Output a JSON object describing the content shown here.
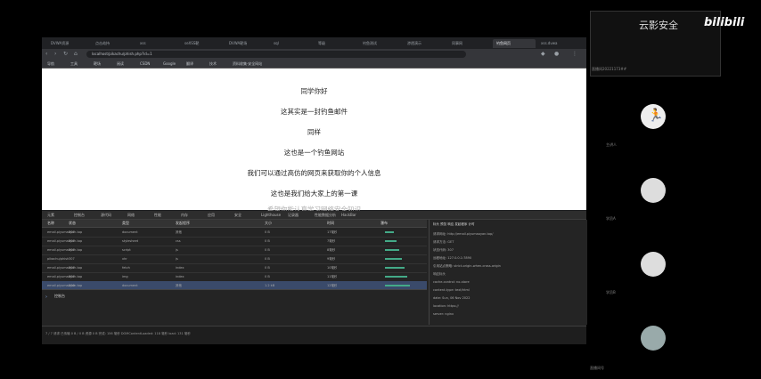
{
  "overlay": {
    "watermark": "云影安全",
    "brand": "bilibili",
    "tile_id": "直播间20221173##",
    "bottom_id": "直播间号"
  },
  "browser": {
    "tabs": [
      "DVWA资源",
      "点击劫持",
      "xss",
      "seXSS靶",
      "DVWA靶场",
      "sql",
      "等级",
      "钓鱼测试",
      "渗透演示",
      "同事网",
      "钓鱼网页",
      "xss.dvwa"
    ],
    "url": "localhost/pikachu/phish.php?id=1",
    "bookmarks": [
      "导航",
      "工具",
      "靶场",
      "阅读",
      "CSDN",
      "Google",
      "翻译",
      "技术",
      "资料收集·安全网站"
    ]
  },
  "page": {
    "lines": [
      "同学你好",
      "这其实是一封钓鱼邮件",
      "同样",
      "这也是一个钓鱼网站",
      "我们可以通过高仿的网页来获取你的个人信息",
      "这也是我们给大家上的第一课"
    ],
    "faded": "希望你能认真学习网络安全知识"
  },
  "devtools": {
    "tabs": [
      "元素",
      "控制台",
      "源代码",
      "网络",
      "性能",
      "内存",
      "应用",
      "安全",
      "Lighthouse",
      "记录器",
      "性能数据分析",
      "HackBar"
    ],
    "columns": [
      "名称",
      "状态",
      "类型",
      "发起程序",
      "大小",
      "时间",
      "瀑布"
    ],
    "rows": [
      {
        "name": "email.piyumaoyan.top",
        "status": "307",
        "type": "document",
        "initiator": "其他",
        "size": "0 B",
        "time": "17毫秒"
      },
      {
        "name": "email.piyumaoyan.top",
        "status": "307",
        "type": "stylesheet",
        "initiator": "css",
        "size": "0 B",
        "time": "7毫秒"
      },
      {
        "name": "email.piyumaoyan.top",
        "status": "307",
        "type": "script",
        "initiator": "js",
        "size": "0 B",
        "time": "8毫秒"
      },
      {
        "name": "pikachu/phish",
        "status": "307",
        "type": "xhr",
        "initiator": "js",
        "size": "0 B",
        "time": "9毫秒"
      },
      {
        "name": "email.piyumaoyan.top",
        "status": "307",
        "type": "fetch",
        "initiator": "index",
        "size": "0 B",
        "time": "10毫秒"
      },
      {
        "name": "email.piyumaoyan.top",
        "status": "307",
        "type": "img",
        "initiator": "index",
        "size": "0 B",
        "time": "11毫秒"
      },
      {
        "name": "email.piyumaoyan.top",
        "status": "200",
        "type": "document",
        "initiator": "其他",
        "size": "1.2 kB",
        "time": "12毫秒"
      }
    ],
    "console_label": "控制台",
    "status": "7 / 7 请求  已传输 0 B / 0 B  资源 0 B  完成: 156 毫秒  DOMContentLoaded: 118 毫秒  load: 131 毫秒",
    "headers_title": "标头  预览  响应  发起程序  计时",
    "headers": [
      "请求网址: http://email.piyumaoyan.top/",
      "请求方法: GET",
      "状态代码: 307",
      "远程地址: 127.0.0.1:7890",
      "引用站点策略: strict-origin-when-cross-origin",
      "响应标头",
      "cache-control: no-store",
      "content-type: text/html",
      "date: Sun, 06 Nov 2022",
      "location: https://",
      "server: nginx"
    ]
  },
  "participants": [
    {
      "name": "主讲人"
    },
    {
      "name": "学员A"
    },
    {
      "name": "学员B"
    },
    {
      "name": "学员C"
    }
  ]
}
